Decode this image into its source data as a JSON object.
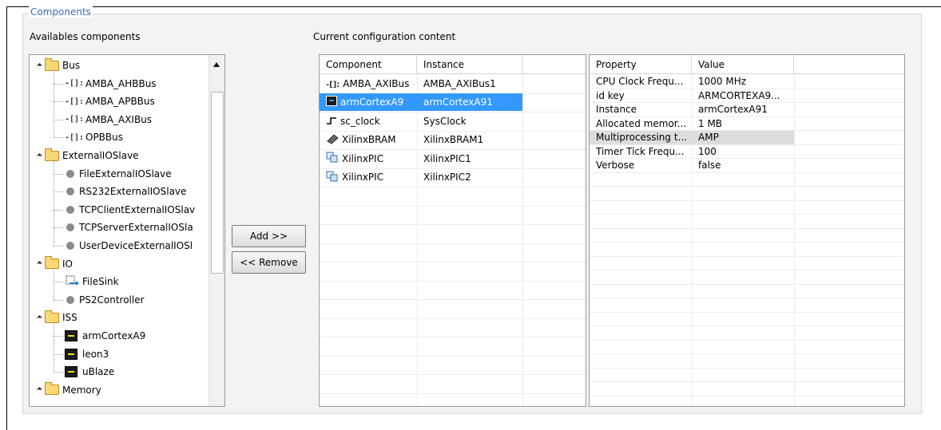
{
  "group": {
    "legend": "Components"
  },
  "left": {
    "title": "Availables components",
    "tree": [
      {
        "label": "Bus",
        "kind": "folder",
        "children": [
          "AMBA_AHBBus",
          "AMBA_APBBus",
          "AMBA_AXIBus",
          "OPBBus"
        ]
      },
      {
        "label": "ExternalIOSlave",
        "kind": "folder",
        "children": [
          "FileExternalIOSlave",
          "RS232ExternalIOSlave",
          "TCPClientExternalIOSlav",
          "TCPServerExternalIOSla",
          "UserDeviceExternalIOSl"
        ]
      },
      {
        "label": "IO",
        "kind": "folder",
        "children": [
          "FileSink",
          "PS2Controller"
        ]
      },
      {
        "label": "ISS",
        "kind": "folder",
        "children": [
          "armCortexA9",
          "leon3",
          "uBlaze"
        ]
      },
      {
        "label": "Memory",
        "kind": "folder",
        "children": []
      }
    ]
  },
  "middle": {
    "title": "Current configuration content",
    "add_label": "Add    >>",
    "remove_label": "<< Remove"
  },
  "config_table": {
    "headers": [
      "Component",
      "Instance"
    ],
    "rows": [
      {
        "component": "AMBA_AXIBus",
        "instance": "AMBA_AXIBus1",
        "icon": "bus-icon"
      },
      {
        "component": "armCortexA9",
        "instance": "armCortexA91",
        "icon": "chip-icon",
        "selected": true
      },
      {
        "component": "sc_clock",
        "instance": "SysClock",
        "icon": "clock-icon"
      },
      {
        "component": "XilinxBRAM",
        "instance": "XilinxBRAM1",
        "icon": "memory-icon"
      },
      {
        "component": "XilinxPIC",
        "instance": "XilinxPIC1",
        "icon": "pic-icon"
      },
      {
        "component": "XilinxPIC",
        "instance": "XilinxPIC2",
        "icon": "pic-icon"
      }
    ]
  },
  "prop_table": {
    "headers": [
      "Property",
      "Value"
    ],
    "rows": [
      {
        "property": "CPU Clock Frequ...",
        "value": "1000 MHz"
      },
      {
        "property": "id key",
        "value": "ARMCORTEXA9..."
      },
      {
        "property": "Instance",
        "value": "armCortexA91"
      },
      {
        "property": "Allocated memor...",
        "value": "1 MB"
      },
      {
        "property": "Multiprocessing t...",
        "value": "AMP",
        "highlighted": true
      },
      {
        "property": "Timer Tick Frequ...",
        "value": "100"
      },
      {
        "property": "Verbose",
        "value": "false"
      }
    ]
  },
  "colors": {
    "selection": "#3399ff",
    "legend": "#3c6bb5"
  }
}
